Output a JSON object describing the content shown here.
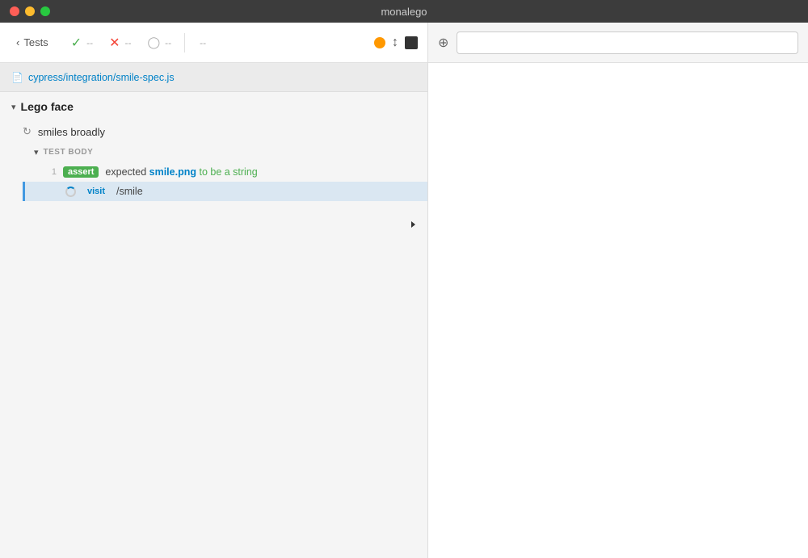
{
  "window": {
    "title": "monalego"
  },
  "traffic_lights": {
    "close_label": "close",
    "minimize_label": "minimize",
    "maximize_label": "maximize"
  },
  "toolbar": {
    "back_label": "Tests",
    "pass_count": "--",
    "fail_count": "--",
    "pending_count": "--",
    "skip_label": "--"
  },
  "filepath": {
    "icon": "📄",
    "path": "cypress/integration/smile-spec.js"
  },
  "suite": {
    "title": "Lego face",
    "chevron": "▾"
  },
  "test": {
    "name": "smiles broadly",
    "reload_icon": "↺"
  },
  "test_body": {
    "label": "TEST BODY",
    "chevron": "▾"
  },
  "commands": [
    {
      "line": "1",
      "type": "assert",
      "badge_class": "assert",
      "text_before": "expected",
      "highlight": "smile.png",
      "text_after": "to be a string",
      "highlighted": false,
      "loading": false
    },
    {
      "line": "",
      "type": "visit",
      "badge_class": "visit",
      "text_before": "",
      "highlight": "",
      "text_after": "/smile",
      "highlighted": true,
      "loading": true
    }
  ],
  "right_panel": {
    "url_placeholder": ""
  }
}
